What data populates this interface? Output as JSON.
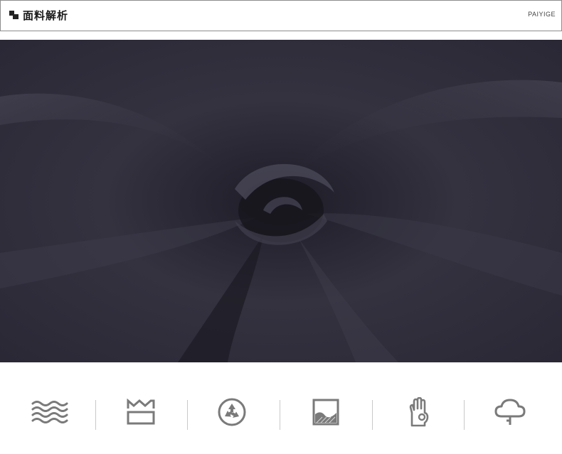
{
  "header": {
    "title": "面料解析",
    "brand": "PAIYIGE"
  },
  "fabric_image": {
    "description_icon": "fabric-swirl-photo",
    "color": "#2f2d3b"
  },
  "features": [
    {
      "icon": "water-waves-icon"
    },
    {
      "icon": "breathable-layer-icon"
    },
    {
      "icon": "recycle-icon"
    },
    {
      "icon": "landscape-image-icon"
    },
    {
      "icon": "hand-touch-icon"
    },
    {
      "icon": "cloud-light-icon"
    }
  ],
  "colors": {
    "icon": "#7a7a7a",
    "divider": "#c9c9c9",
    "border": "#8c8c8c"
  }
}
